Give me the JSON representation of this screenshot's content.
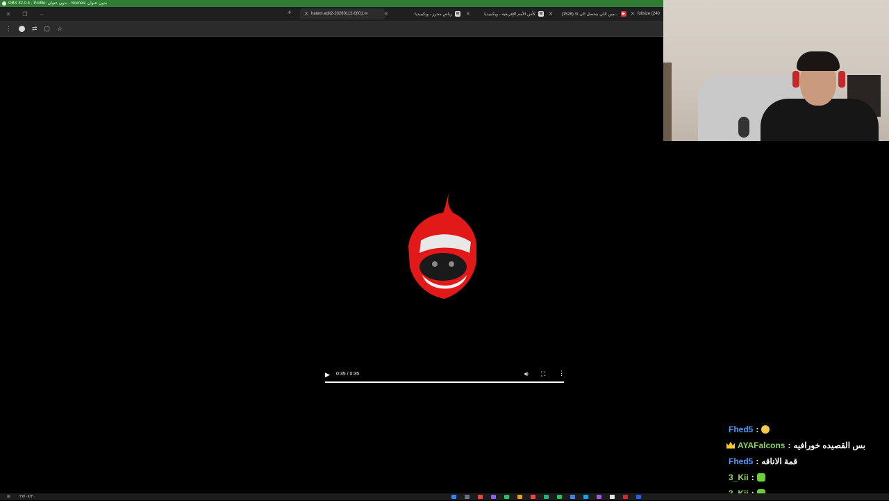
{
  "obs": {
    "title": "OBS 32.0.4 - Profile: بدون عنوان - Scenes: بدون عنوان"
  },
  "browser": {
    "tabs": [
      {
        "label": "hatem.edit2-20260112-0001.m",
        "favicon": "",
        "active": true
      },
      {
        "label": "رياض محرز - ويكيبيديا",
        "favicon": "W",
        "active": false
      },
      {
        "label": "كأس الأمم الإفريقية - ويكيبيديا",
        "favicon": "W",
        "active": false
      },
      {
        "label": "(1526) مين اللي بيحصل الى الا...",
        "favicon": "yt",
        "active": false
      },
      {
        "label": "fullsize (240",
        "favicon": "",
        "active": false
      }
    ]
  },
  "video": {
    "time": "0:35 / 0:35",
    "progress": 1.0
  },
  "chat": [
    {
      "user": "Fhed5",
      "message": "",
      "emoji": "heart-eyes-emoji",
      "color": "blue",
      "badge": ""
    },
    {
      "user": "AYAFalcons",
      "message": "بس القصيده خورافيه",
      "emoji": "",
      "color": "green",
      "badge": "crown-icon"
    },
    {
      "user": "Fhed5",
      "message": "قمة الاناقه",
      "emoji": "",
      "color": "blue",
      "badge": ""
    },
    {
      "user": "3_Kii",
      "message": "",
      "emoji": "green-emote",
      "color": "green",
      "badge": ""
    },
    {
      "user": "3_Kii",
      "message": "",
      "emoji": "green-emote",
      "color": "green",
      "badge": ""
    }
  ],
  "taskbar": {
    "date": "٢٧/٠٧/٢٠"
  },
  "colors": {
    "obs_bar": "#2f7d32",
    "chat_user_blue": "#4a9bf7",
    "chat_user_green": "#8bd35d",
    "logo_red": "#e11919"
  }
}
